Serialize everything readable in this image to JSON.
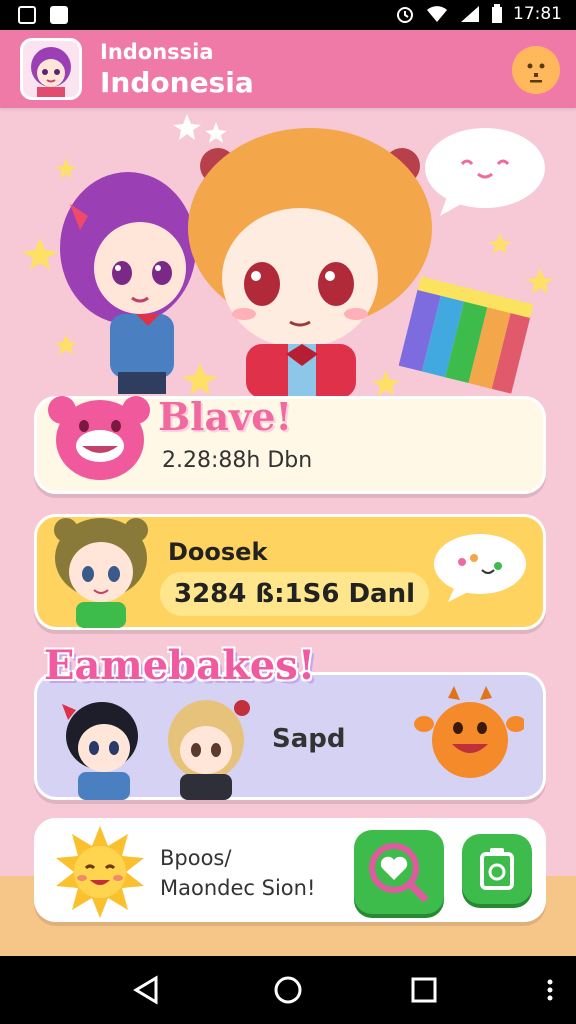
{
  "status_bar": {
    "time": "17:81"
  },
  "app_bar": {
    "title_line1": "Indonssia",
    "title_line2": "Indonesia"
  },
  "cards": [
    {
      "title": "Blave!",
      "subtitle": "2.28:88h Dbn"
    },
    {
      "title": "Doosek",
      "value": "3284 ß:1S6 Danl"
    },
    {
      "banner": "Eamebakes!",
      "label": "Sapd"
    },
    {
      "line1": "Bpoos/",
      "line2": "Maondec Sion!"
    }
  ],
  "colors": {
    "app_bar": "#f07aa7",
    "background": "#f7c9d6",
    "card_yellow": "#ffd35f",
    "card_lavender": "#d6d2f3",
    "accent_green": "#3dbb4b"
  },
  "icons": {
    "nav": [
      "back-icon",
      "home-icon",
      "recents-icon",
      "more-icon"
    ]
  }
}
